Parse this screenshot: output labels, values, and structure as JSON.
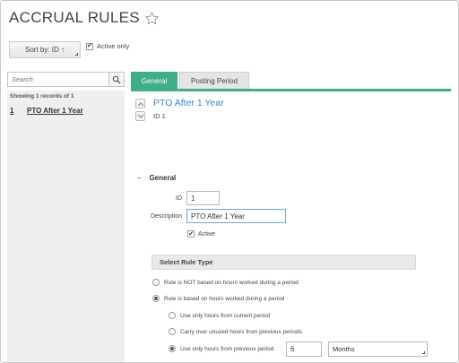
{
  "page": {
    "title": "ACCRUAL RULES"
  },
  "toolbar": {
    "sort_label": "Sort by: ID ↑",
    "active_only_label": "Active only",
    "active_only_checked": true
  },
  "search": {
    "placeholder": "Search",
    "value": ""
  },
  "results": {
    "summary": "Showing 1 records of 1",
    "items": [
      {
        "num": "1",
        "name": "PTO After 1 Year"
      }
    ]
  },
  "tabs": [
    {
      "label": "General",
      "active": true
    },
    {
      "label": "Posting Period",
      "active": false
    }
  ],
  "record": {
    "title": "PTO After 1 Year",
    "id_line": "ID 1"
  },
  "general_section": {
    "heading": "General",
    "id_label": "ID",
    "id_value": "1",
    "description_label": "Description",
    "description_value": "PTO After 1 Year",
    "active_label": "Active",
    "active_checked": true
  },
  "rule_type": {
    "heading": "Select Rule Type",
    "options": [
      {
        "label": "Rule is NOT based on hours worked during a period",
        "selected": false
      },
      {
        "label": "Rule is based on hours worked during a period",
        "selected": true
      }
    ],
    "sub_options": [
      {
        "label": "Use only hours from current period",
        "selected": false
      },
      {
        "label": "Carry over unused hours from previous periods",
        "selected": false
      },
      {
        "label": "Use only hours from previous period",
        "selected": true
      }
    ],
    "previous_period_count": "6",
    "previous_period_unit": "Months"
  },
  "colors": {
    "accent": "#3fae8b",
    "link": "#3a86c8",
    "panel": "#efefef"
  },
  "icons": {
    "favorite": "star-outline-icon",
    "search": "magnifier-icon",
    "prev": "chevron-up-icon",
    "next": "chevron-down-icon"
  }
}
